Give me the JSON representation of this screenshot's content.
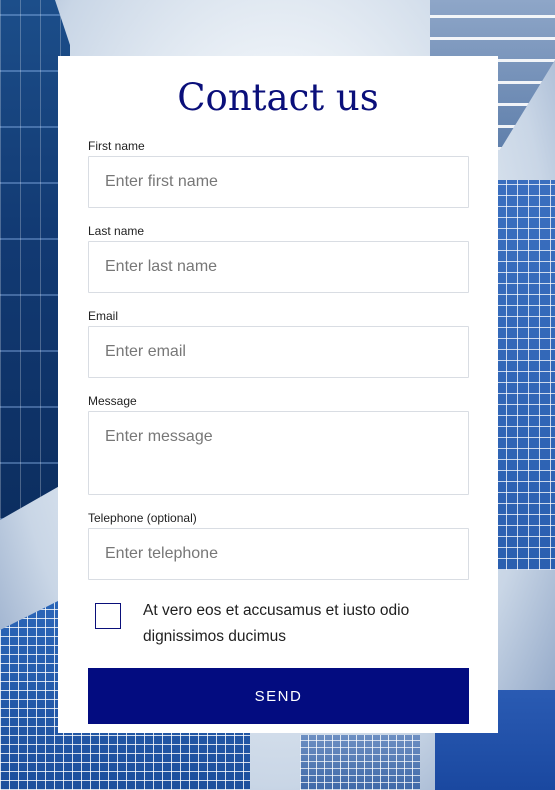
{
  "form": {
    "title": "Contact us",
    "fields": [
      {
        "label": "First name",
        "placeholder": "Enter first name",
        "value": ""
      },
      {
        "label": "Last name",
        "placeholder": "Enter last name",
        "value": ""
      },
      {
        "label": "Email",
        "placeholder": "Enter email",
        "value": ""
      },
      {
        "label": "Message",
        "placeholder": "Enter message",
        "value": ""
      },
      {
        "label": "Telephone (optional)",
        "placeholder": "Enter telephone",
        "value": ""
      }
    ],
    "consent": {
      "text": "At vero eos et accusamus et iusto odio dignissimos ducimus",
      "checked": false
    },
    "send_label": "SEND"
  },
  "colors": {
    "accent": "#030c80",
    "title": "#0a0f7a",
    "card": "#ffffff",
    "field_border": "#d9dde3"
  }
}
